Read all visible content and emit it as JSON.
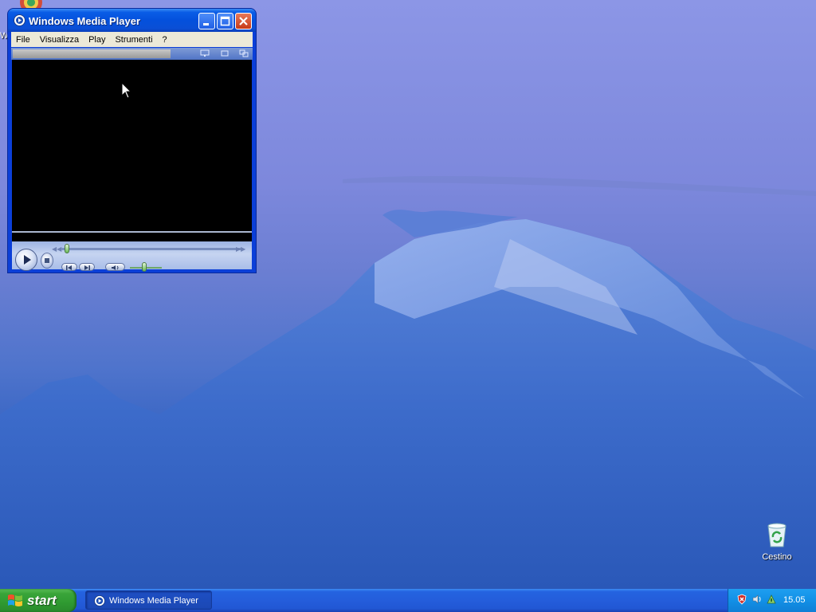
{
  "desktop": {
    "partial_icon_label": "W",
    "recycle_bin_label": "Cestino"
  },
  "window": {
    "title": "Windows Media Player",
    "menu": [
      "File",
      "Visualizza",
      "Play",
      "Strumenti",
      "?"
    ]
  },
  "taskbar": {
    "start_label": "start",
    "task_label": "Windows Media Player",
    "clock": "15.05"
  },
  "colors": {
    "titlebar": "#0450dc",
    "taskbar": "#245ddb",
    "start_button": "#3aa53a",
    "tray": "#1290e6"
  }
}
